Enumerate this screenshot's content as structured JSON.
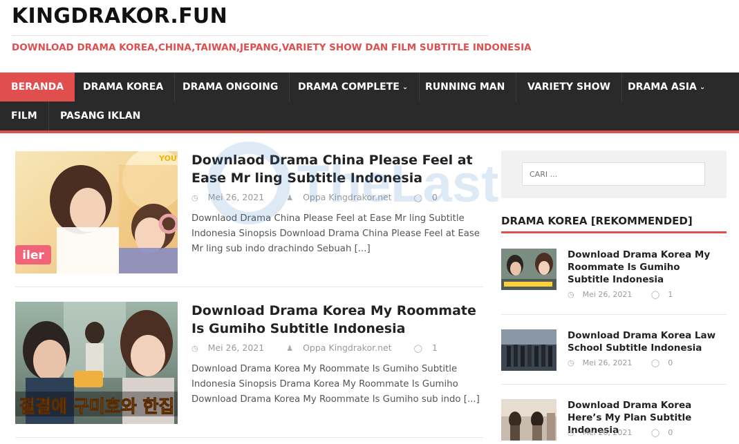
{
  "site": {
    "title": "KINGDRAKOR.FUN",
    "tagline": "DOWNLOAD DRAMA KOREA,CHINA,TAIWAN,JEPANG,VARIETY SHOW DAN FILM SUBTITLE INDONESIA"
  },
  "nav": {
    "items": [
      {
        "label": "BERANDA",
        "active": true
      },
      {
        "label": "DRAMA KOREA"
      },
      {
        "label": "DRAMA ONGOING"
      },
      {
        "label": "DRAMA COMPLETE",
        "dropdown": true
      },
      {
        "label": "RUNNING MAN"
      },
      {
        "label": "VARIETY SHOW"
      },
      {
        "label": "DRAMA ASIA",
        "dropdown": true
      },
      {
        "label": "FILM"
      },
      {
        "label": "PASANG IKLAN"
      }
    ]
  },
  "watermark": {
    "text": "TheLast"
  },
  "posts": [
    {
      "title": "Downlaod Drama China Please Feel at Ease Mr ling Subtitle Indonesia",
      "date": "Mei 26, 2021",
      "author": "Oppa Kingdrakor.net",
      "comments": "0",
      "excerpt": "Downlaod Drama China Please Feel at Ease Mr ling Subtitle Indonesia Sinopsis Download Drama China Please Feel at Ease Mr ling sub indo drachindo Sebuah [...]",
      "thumb_label": "YOU",
      "thumb_badge": "iler"
    },
    {
      "title": "Download Drama Korea My Roommate Is Gumiho Subtitle Indonesia",
      "date": "Mei 26, 2021",
      "author": "Oppa Kingdrakor.net",
      "comments": "1",
      "excerpt": "Download Drama Korea My Roommate Is Gumiho Subtitle Indonesia Sinopsis Drama Korea My Roommate Is Gumiho Download Drama Korea My Roommate Is Gumiho sub indo [...]",
      "thumb_caption": "절결에 구미호와 한집 살"
    }
  ],
  "sidebar": {
    "search_placeholder": "CARI ...",
    "widget_title": "DRAMA KOREA [REKOMMENDED]",
    "posts": [
      {
        "title": "Download Drama Korea My Roommate Is Gumiho Subtitle Indonesia",
        "date": "Mei 26, 2021",
        "comments": "1"
      },
      {
        "title": "Download Drama Korea Law School Subtitle Indonesia",
        "date": "Mei 26, 2021",
        "comments": "0"
      },
      {
        "title": "Download Drama Korea Here’s My Plan Subtitle Indonesia",
        "date": "Mei 26, 2021",
        "comments": "0"
      }
    ]
  },
  "colors": {
    "accent": "#e04e4e",
    "nav_bg": "#2a2a2a"
  },
  "icons": {
    "date": "clock-icon",
    "author": "user-icon",
    "comments": "comment-icon"
  }
}
